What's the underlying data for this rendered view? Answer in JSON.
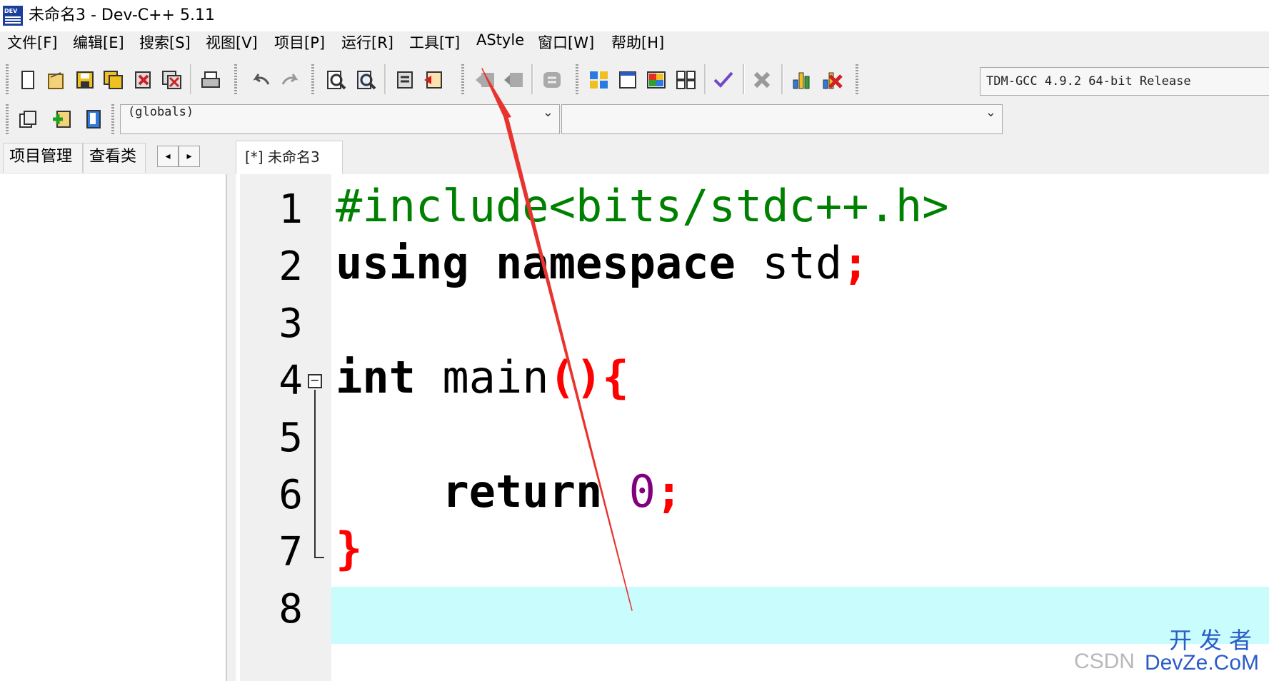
{
  "window": {
    "title": "未命名3 - Dev-C++ 5.11",
    "icon": "dev-cpp-app-icon",
    "icon_label": "DEV"
  },
  "menu": [
    "文件[F]",
    "编辑[E]",
    "搜索[S]",
    "视图[V]",
    "项目[P]",
    "运行[R]",
    "工具[T]",
    "AStyle",
    "窗口[W]",
    "帮助[H]"
  ],
  "toolbar": {
    "compiler_select": "TDM-GCC 4.9.2 64-bit Release",
    "scope_select": "(globals)",
    "member_select": ""
  },
  "left_panel": {
    "tabs": [
      "项目管理",
      "查看类"
    ],
    "nav_prev": "◂",
    "nav_next": "▸"
  },
  "editor": {
    "tab_label": "[*] 未命名3",
    "line_numbers": [
      "1",
      "2",
      "3",
      "4",
      "5",
      "6",
      "7",
      "8"
    ],
    "lines": {
      "l1": "#include<bits/stdc++.h>",
      "l2_using": "using",
      "l2_namespace": "namespace",
      "l2_std": "std",
      "l2_semi": ";",
      "l4_int": "int",
      "l4_main": "main",
      "l4_paren": "()",
      "l4_brace": "{",
      "l6_return": "return",
      "l6_zero": "0",
      "l6_semi": ";",
      "l7_brace": "}"
    },
    "fold_marker": "−",
    "current_line": 8
  },
  "watermark": {
    "csdn": "CSDN",
    "cn": "开发者",
    "en": "DevZe.CoM"
  },
  "colors": {
    "preprocessor": "#008000",
    "symbol": "#ff0000",
    "number": "#800080",
    "active_line": "#c8fcfd",
    "annotation_arrow": "#e8342e"
  }
}
